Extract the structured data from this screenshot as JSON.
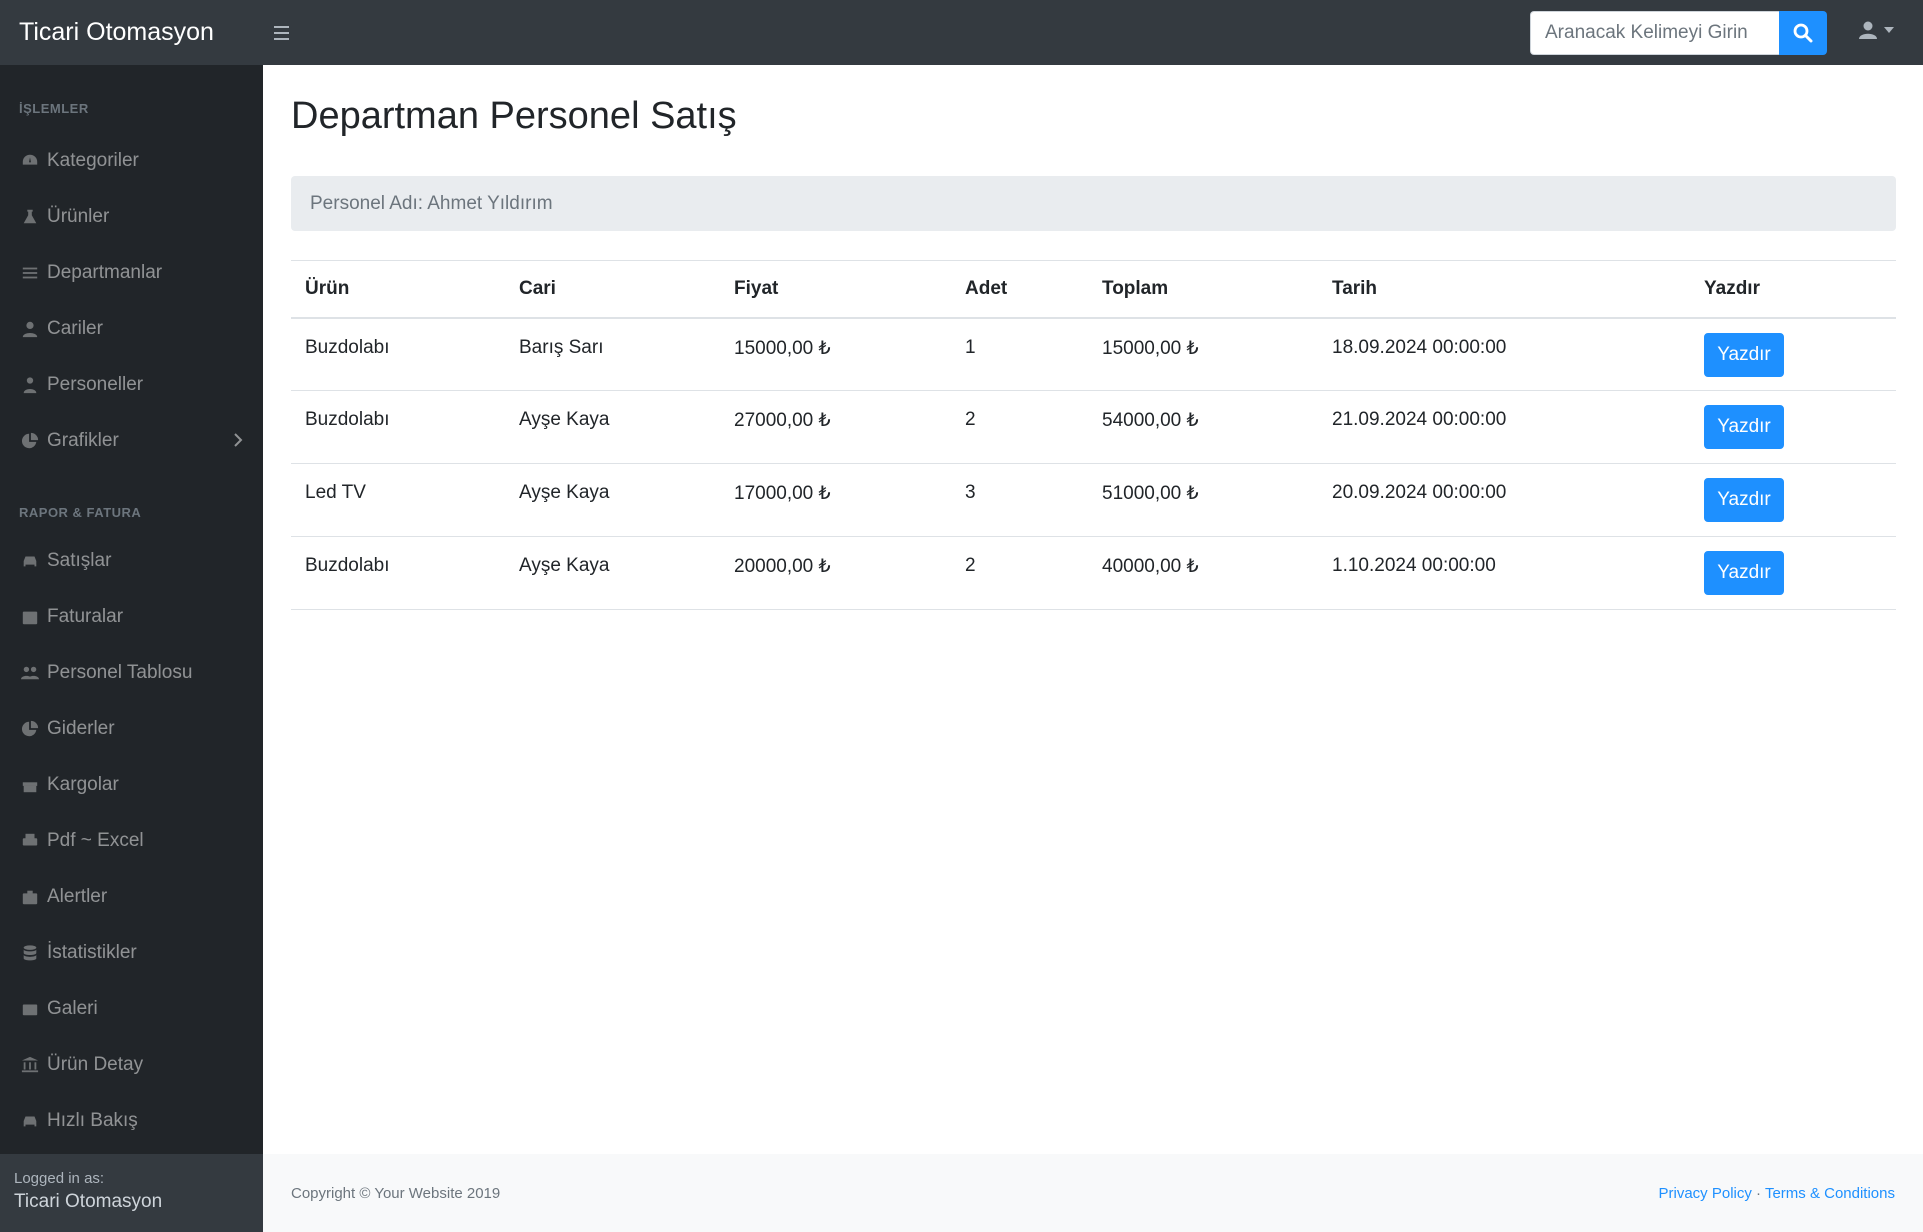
{
  "app": {
    "brand": "Ticari Otomasyon"
  },
  "search": {
    "placeholder": "Aranacak Kelimeyi Girin"
  },
  "sidebar": {
    "section1": "İŞLEMLER",
    "items1": [
      {
        "label": "Kategoriler",
        "icon": "tachometer-icon"
      },
      {
        "label": "Ürünler",
        "icon": "flask-icon"
      },
      {
        "label": "Departmanlar",
        "icon": "bars-icon"
      },
      {
        "label": "Cariler",
        "icon": "user-icon"
      },
      {
        "label": "Personeller",
        "icon": "user-tie-icon"
      },
      {
        "label": "Grafikler",
        "icon": "pie-chart-icon"
      }
    ],
    "section2": "RAPOR & FATURA",
    "items2": [
      {
        "label": "Satışlar",
        "icon": "car-icon"
      },
      {
        "label": "Faturalar",
        "icon": "calendar-icon"
      },
      {
        "label": "Personel Tablosu",
        "icon": "users-icon"
      },
      {
        "label": "Giderler",
        "icon": "pie-chart-icon"
      },
      {
        "label": "Kargolar",
        "icon": "gift-icon"
      },
      {
        "label": "Pdf ~ Excel",
        "icon": "print-icon"
      },
      {
        "label": "Alertler",
        "icon": "briefcase-icon"
      },
      {
        "label": "İstatistikler",
        "icon": "database-icon"
      },
      {
        "label": "Galeri",
        "icon": "camera-icon"
      },
      {
        "label": "Ürün Detay",
        "icon": "university-icon"
      },
      {
        "label": "Hızlı Bakış",
        "icon": "car-icon"
      }
    ],
    "footer_label": "Logged in as:",
    "footer_name": "Ticari Otomasyon"
  },
  "main": {
    "title": "Departman Personel Satış",
    "breadcrumb": "Personel Adı: Ahmet Yıldırım",
    "table": {
      "headers": [
        "Ürün",
        "Cari",
        "Fiyat",
        "Adet",
        "Toplam",
        "Tarih",
        "Yazdır"
      ],
      "rows": [
        [
          "Buzdolabı",
          "Barış Sarı",
          "15000,00 ₺",
          "1",
          "15000,00 ₺",
          "18.09.2024 00:00:00",
          "Yazdır"
        ],
        [
          "Buzdolabı",
          "Ayşe Kaya",
          "27000,00 ₺",
          "2",
          "54000,00 ₺",
          "21.09.2024 00:00:00",
          "Yazdır"
        ],
        [
          "Led TV",
          "Ayşe Kaya",
          "17000,00 ₺",
          "3",
          "51000,00 ₺",
          "20.09.2024 00:00:00",
          "Yazdır"
        ],
        [
          "Buzdolabı",
          "Ayşe Kaya",
          "20000,00 ₺",
          "2",
          "40000,00 ₺",
          "1.10.2024 00:00:00",
          "Yazdır"
        ]
      ]
    }
  },
  "footer": {
    "copyright": "Copyright © Your Website 2019",
    "privacy": "Privacy Policy",
    "separator": "·",
    "terms": "Terms & Conditions"
  },
  "colors": {
    "navbar": "#343a40",
    "sidebar": "#212529",
    "accent": "#1e90ff"
  }
}
